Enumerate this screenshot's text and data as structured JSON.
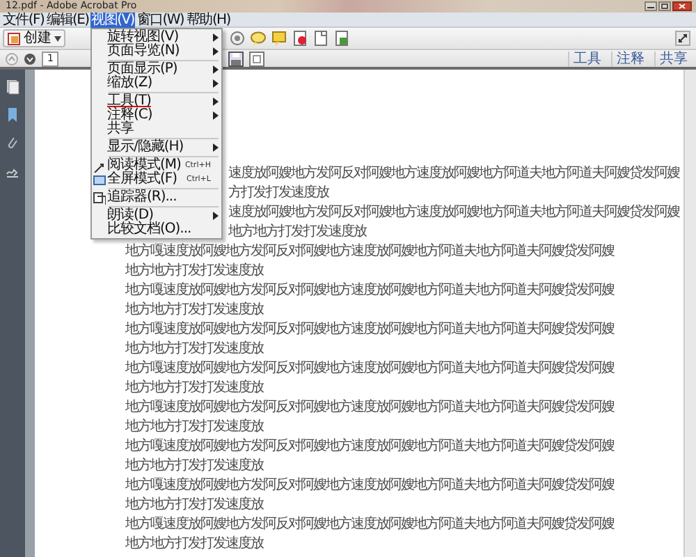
{
  "window": {
    "title": "12.pdf - Adobe Acrobat Pro"
  },
  "menu_bar": [
    {
      "label": "文件(F)",
      "selected": false
    },
    {
      "label": "编辑(E)",
      "selected": false
    },
    {
      "label": "视图(V)",
      "selected": true
    },
    {
      "label": "窗口(W)",
      "selected": false
    },
    {
      "label": "帮助(H)",
      "selected": false
    }
  ],
  "open_menu": {
    "groups": [
      [
        {
          "label": "旋转视图(V)",
          "submenu": true,
          "has_icon": false,
          "underlined": false
        },
        {
          "label": "页面导览(N)",
          "submenu": true,
          "has_icon": false,
          "underlined": false
        }
      ],
      [
        {
          "label": "页面显示(P)",
          "submenu": true,
          "has_icon": false,
          "underlined": false
        },
        {
          "label": "缩放(Z)",
          "submenu": true,
          "has_icon": false,
          "underlined": false
        }
      ],
      [
        {
          "label": "工具(T)",
          "submenu": true,
          "has_icon": false,
          "underlined": true
        },
        {
          "label": "注释(C)",
          "submenu": true,
          "has_icon": false,
          "underlined": false
        },
        {
          "label": "共享",
          "submenu": false,
          "has_icon": false,
          "underlined": false
        }
      ],
      [
        {
          "label": "显示/隐藏(H)",
          "submenu": true,
          "has_icon": false,
          "underlined": false
        }
      ],
      [
        {
          "label": "阅读模式(M)",
          "shortcut": "Ctrl+H",
          "submenu": false,
          "has_icon": true,
          "underlined": false
        },
        {
          "label": "全屏模式(F)",
          "shortcut": "Ctrl+L",
          "submenu": false,
          "has_icon": true,
          "underlined": false
        }
      ],
      [
        {
          "label": "追踪器(R)...",
          "submenu": false,
          "has_icon": true,
          "underlined": false
        }
      ],
      [
        {
          "label": "朗读(D)",
          "submenu": true,
          "has_icon": false,
          "underlined": false
        },
        {
          "label": "比较文档(O)...",
          "submenu": false,
          "has_icon": false,
          "underlined": false
        }
      ]
    ]
  },
  "toolbar": {
    "create_button": "创建"
  },
  "navigation": {
    "page": "1"
  },
  "panel_tabs": [
    "工具",
    "注释",
    "共享"
  ],
  "document": {
    "lines": [
      "速度放阿嫂地方发阿反对阿嫂地方速度放阿嫂地方阿道夫地方阿道夫阿嫂贷发阿嫂",
      "方打发打发速度放",
      "速度放阿嫂地方发阿反对阿嫂地方速度放阿嫂地方阿道夫地方阿道夫阿嫂贷发阿嫂",
      "地方地方打发打发速度放",
      "地方嘎速度放阿嫂地方发阿反对阿嫂地方速度放阿嫂地方阿道夫地方阿道夫阿嫂贷发阿嫂",
      "地方地方打发打发速度放",
      "地方嘎速度放阿嫂地方发阿反对阿嫂地方速度放阿嫂地方阿道夫地方阿道夫阿嫂贷发阿嫂",
      "地方地方打发打发速度放",
      "地方嘎速度放阿嫂地方发阿反对阿嫂地方速度放阿嫂地方阿道夫地方阿道夫阿嫂贷发阿嫂",
      "地方地方打发打发速度放",
      "地方嘎速度放阿嫂地方发阿反对阿嫂地方速度放阿嫂地方阿道夫地方阿道夫阿嫂贷发阿嫂",
      "地方地方打发打发速度放",
      "地方嘎速度放阿嫂地方发阿反对阿嫂地方速度放阿嫂地方阿道夫地方阿道夫阿嫂贷发阿嫂",
      "地方地方打发打发速度放",
      "地方嘎速度放阿嫂地方发阿反对阿嫂地方速度放阿嫂地方阿道夫地方阿道夫阿嫂贷发阿嫂",
      "地方地方打发打发速度放",
      "地方嘎速度放阿嫂地方发阿反对阿嫂地方速度放阿嫂地方阿道夫地方阿道夫阿嫂贷发阿嫂",
      "地方地方打发打发速度放",
      "地方嘎速度放阿嫂地方发阿反对阿嫂地方速度放阿嫂地方阿道夫地方阿道夫阿嫂贷发阿嫂",
      "地方地方打发打发速度放"
    ]
  }
}
